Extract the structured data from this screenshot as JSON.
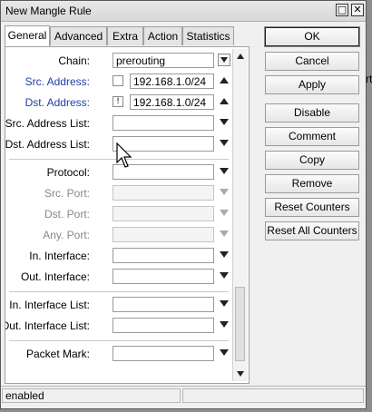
{
  "window": {
    "title": "New Mangle Rule"
  },
  "tabs": [
    "General",
    "Advanced",
    "Extra",
    "Action",
    "Statistics"
  ],
  "fields": {
    "chain": {
      "label": "Chain:",
      "value": "prerouting"
    },
    "src_address": {
      "label": "Src. Address:",
      "value": "192.168.1.0/24",
      "negate": ""
    },
    "dst_address": {
      "label": "Dst. Address:",
      "value": "192.168.1.0/24",
      "negate": "!"
    },
    "src_address_list": {
      "label": "Src. Address List:"
    },
    "dst_address_list": {
      "label": "Dst. Address List:"
    },
    "protocol": {
      "label": "Protocol:"
    },
    "src_port": {
      "label": "Src. Port:"
    },
    "dst_port": {
      "label": "Dst. Port:"
    },
    "any_port": {
      "label": "Any. Port:"
    },
    "in_interface": {
      "label": "In. Interface:"
    },
    "out_interface": {
      "label": "Out. Interface:"
    },
    "in_interface_list": {
      "label": "In. Interface List:"
    },
    "out_interface_list": {
      "label": "Out. Interface List:"
    },
    "packet_mark": {
      "label": "Packet Mark:"
    }
  },
  "buttons": [
    "OK",
    "Cancel",
    "Apply",
    "Disable",
    "Comment",
    "Copy",
    "Remove",
    "Reset Counters",
    "Reset All Counters"
  ],
  "status": {
    "text": "enabled"
  },
  "background_text": "rt",
  "colors": {
    "field_label_blue": "#1f3fa6",
    "disabled_label": "#888888"
  }
}
